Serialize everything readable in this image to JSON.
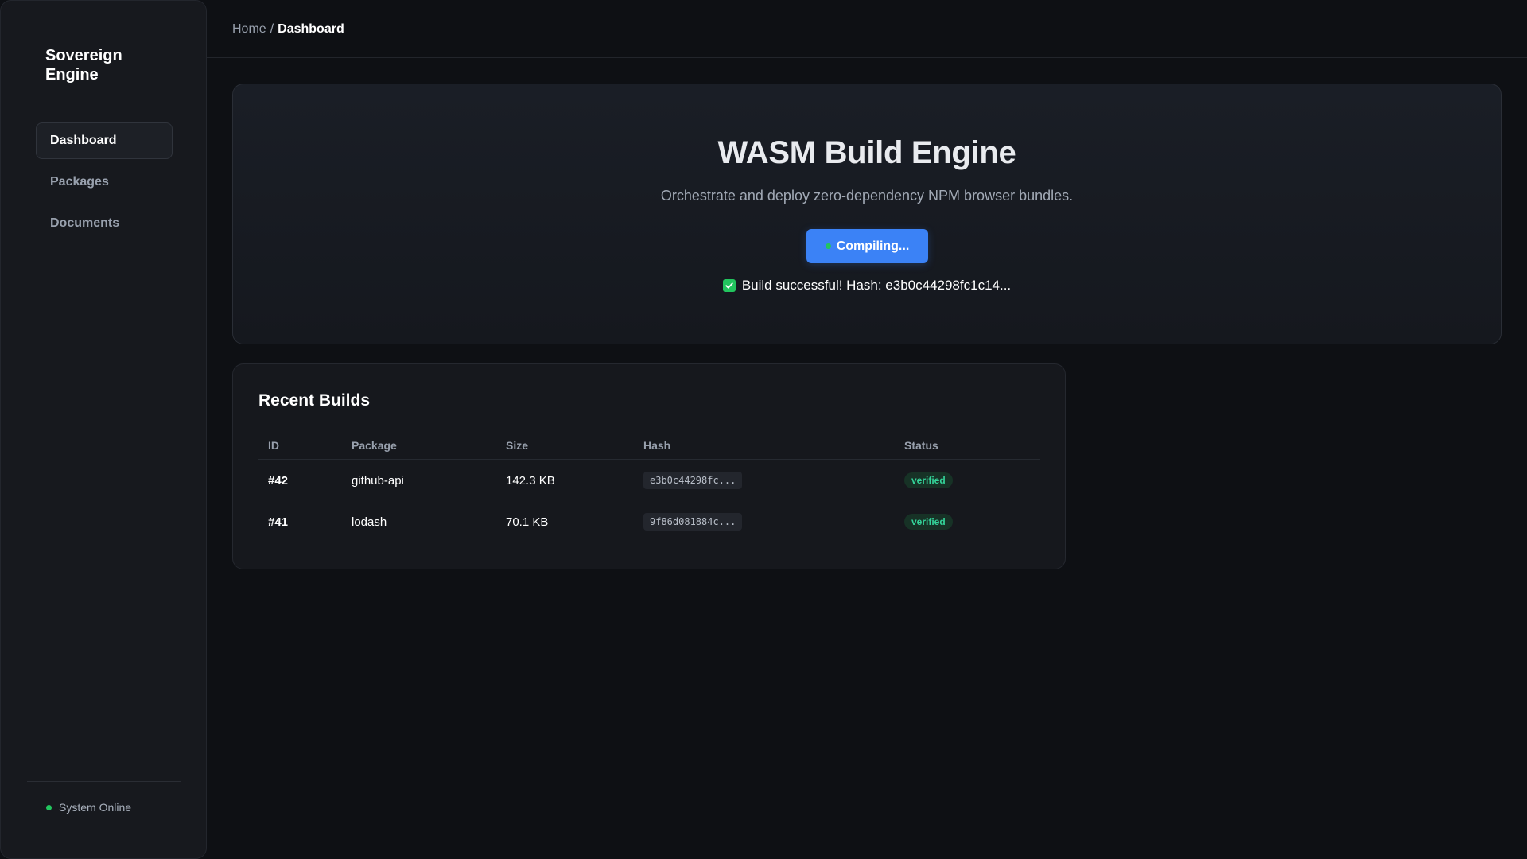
{
  "sidebar": {
    "brand": "Sovereign Engine",
    "nav": [
      {
        "label": "Dashboard",
        "active": true
      },
      {
        "label": "Packages",
        "active": false
      },
      {
        "label": "Documents",
        "active": false
      }
    ],
    "status": "System Online"
  },
  "breadcrumb": {
    "home": "Home",
    "separator": "/",
    "current": "Dashboard"
  },
  "hero": {
    "title": "WASM Build Engine",
    "subtitle": "Orchestrate and deploy zero-dependency NPM browser bundles.",
    "button_label": "Compiling...",
    "result": "Build successful! Hash: e3b0c44298fc1c14..."
  },
  "builds": {
    "title": "Recent Builds",
    "columns": [
      "ID",
      "Package",
      "Size",
      "Hash",
      "Status"
    ],
    "rows": [
      {
        "id": "#42",
        "package": "github-api",
        "size": "142.3 KB",
        "hash": "e3b0c44298fc...",
        "status": "verified"
      },
      {
        "id": "#41",
        "package": "lodash",
        "size": "70.1 KB",
        "hash": "9f86d081884c...",
        "status": "verified"
      }
    ]
  },
  "colors": {
    "accent": "#3b82f6",
    "success": "#22c55e",
    "background": "#0e1014",
    "sidebar": "#17191e"
  }
}
